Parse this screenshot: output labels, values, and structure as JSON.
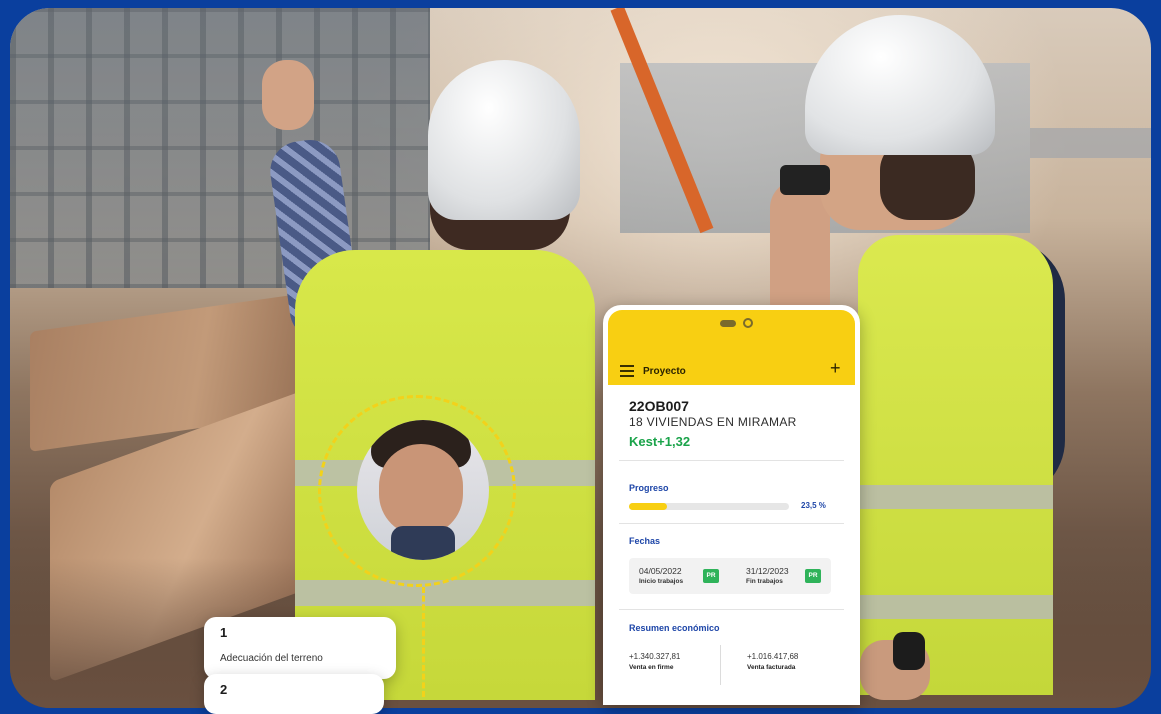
{
  "phone": {
    "header_title": "Proyecto",
    "project_code": "22OB007",
    "project_name": "18 VIVIENDAS EN MIRAMAR",
    "kest": "Kest+1,32",
    "progress": {
      "title": "Progreso",
      "value_label": "23,5 %",
      "fraction": 0.235
    },
    "dates": {
      "title": "Fechas",
      "start_value": "04/05/2022",
      "start_label": "Inicio trabajos",
      "start_badge": "PR",
      "end_value": "31/12/2023",
      "end_label": "Fin trabajos",
      "end_badge": "PR"
    },
    "summary": {
      "title": "Resumen económico",
      "firm_value": "+1.340.327,81",
      "firm_label": "Venta en firme",
      "billed_value": "+1.016.417,68",
      "billed_label": "Venta facturada"
    }
  },
  "tasks": [
    {
      "number": "1",
      "name": "Adecuación del terreno"
    },
    {
      "number": "2",
      "name": ""
    }
  ],
  "colors": {
    "frame": "#0a3f9e",
    "accent_yellow": "#f8cf12",
    "link_blue": "#1e46a8",
    "positive_green": "#1aa34a",
    "badge_green": "#2fb35a"
  },
  "icons": [
    "menu-icon",
    "plus-icon"
  ]
}
